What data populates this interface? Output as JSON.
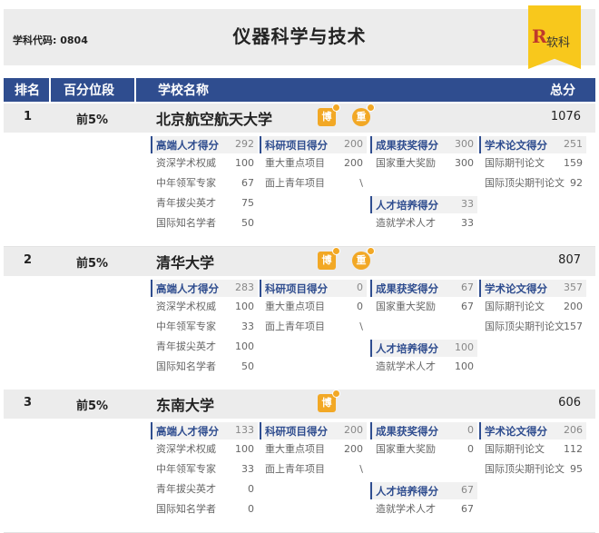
{
  "header": {
    "subject_code": "学科代码: 0804",
    "title": "仪器科学与技术",
    "logo_letter": "R",
    "logo_text": "软科"
  },
  "columns": {
    "rank": "排名",
    "percentile": "百分位段",
    "school": "学校名称",
    "total": "总分"
  },
  "universities": [
    {
      "rank": "1",
      "percentile": "前5%",
      "name": "北京航空航天大学",
      "total": "1076",
      "badges": [
        "博",
        "重"
      ],
      "blocks": [
        {
          "title": "高端人才得分",
          "score": "292",
          "items": [
            [
              "资深学术权威",
              "100"
            ],
            [
              "中年领军专家",
              "67"
            ],
            [
              "青年拔尖英才",
              "75"
            ],
            [
              "国际知名学者",
              "50"
            ]
          ]
        },
        {
          "title": "科研项目得分",
          "score": "200",
          "items": [
            [
              "重大重点项目",
              "200"
            ],
            [
              "面上青年项目",
              "\\"
            ]
          ]
        },
        {
          "title": "成果获奖得分",
          "score": "300",
          "items": [
            [
              "国家重大奖励",
              "300"
            ]
          ]
        },
        {
          "title": "人才培养得分",
          "score": "33",
          "items": [
            [
              "造就学术人才",
              "33"
            ]
          ]
        },
        {
          "title": "学术论文得分",
          "score": "251",
          "items": [
            [
              "国际期刊论文",
              "159"
            ],
            [
              "国际顶尖期刊论文",
              "92"
            ]
          ]
        }
      ]
    },
    {
      "rank": "2",
      "percentile": "前5%",
      "name": "清华大学",
      "total": "807",
      "badges": [
        "博",
        "重"
      ],
      "blocks": [
        {
          "title": "高端人才得分",
          "score": "283",
          "items": [
            [
              "资深学术权威",
              "100"
            ],
            [
              "中年领军专家",
              "33"
            ],
            [
              "青年拔尖英才",
              "100"
            ],
            [
              "国际知名学者",
              "50"
            ]
          ]
        },
        {
          "title": "科研项目得分",
          "score": "0",
          "items": [
            [
              "重大重点项目",
              "0"
            ],
            [
              "面上青年项目",
              "\\"
            ]
          ]
        },
        {
          "title": "成果获奖得分",
          "score": "67",
          "items": [
            [
              "国家重大奖励",
              "67"
            ]
          ]
        },
        {
          "title": "人才培养得分",
          "score": "100",
          "items": [
            [
              "造就学术人才",
              "100"
            ]
          ]
        },
        {
          "title": "学术论文得分",
          "score": "357",
          "items": [
            [
              "国际期刊论文",
              "200"
            ],
            [
              "国际顶尖期刊论文",
              "157"
            ]
          ]
        }
      ]
    },
    {
      "rank": "3",
      "percentile": "前5%",
      "name": "东南大学",
      "total": "606",
      "badges": [
        "博"
      ],
      "blocks": [
        {
          "title": "高端人才得分",
          "score": "133",
          "items": [
            [
              "资深学术权威",
              "100"
            ],
            [
              "中年领军专家",
              "33"
            ],
            [
              "青年拔尖英才",
              "0"
            ],
            [
              "国际知名学者",
              "0"
            ]
          ]
        },
        {
          "title": "科研项目得分",
          "score": "200",
          "items": [
            [
              "重大重点项目",
              "200"
            ],
            [
              "面上青年项目",
              "\\"
            ]
          ]
        },
        {
          "title": "成果获奖得分",
          "score": "0",
          "items": [
            [
              "国家重大奖励",
              "0"
            ]
          ]
        },
        {
          "title": "人才培养得分",
          "score": "67",
          "items": [
            [
              "造就学术人才",
              "67"
            ]
          ]
        },
        {
          "title": "学术论文得分",
          "score": "206",
          "items": [
            [
              "国际期刊论文",
              "112"
            ],
            [
              "国际顶尖期刊论文",
              "95"
            ]
          ]
        }
      ]
    }
  ],
  "colors": {
    "header_bg": "#2f4d8f",
    "badge": "#f2a825",
    "ribbon": "#f8c81c"
  }
}
